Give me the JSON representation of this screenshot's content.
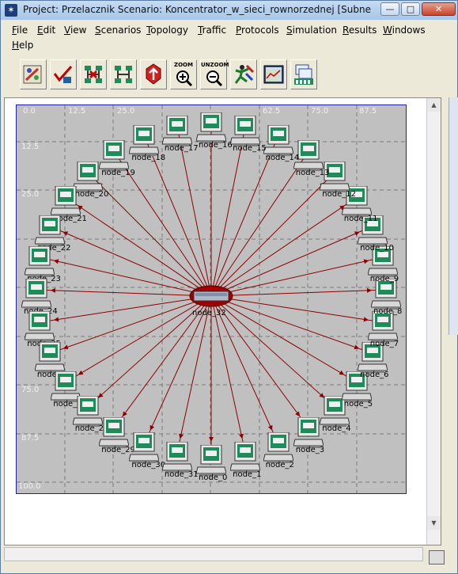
{
  "window": {
    "title": "Project: Przelacznik Scenario: Koncentrator_w_sieci_rownorzednej  [Subnet: top.Off",
    "min_glyph": "—",
    "max_glyph": "□",
    "close_glyph": "✕"
  },
  "menu": {
    "items": [
      "File",
      "Edit",
      "View",
      "Scenarios",
      "Topology",
      "Traffic",
      "Protocols",
      "Simulation",
      "Results",
      "Windows",
      "Help"
    ]
  },
  "toolbar": {
    "buttons": [
      {
        "icon": "open-palette-icon"
      },
      {
        "icon": "check-links-icon"
      },
      {
        "icon": "fail-link-icon"
      },
      {
        "icon": "recover-link-icon"
      },
      {
        "icon": "return-to-parent-icon"
      },
      {
        "icon": "zoom-in-icon",
        "caption": "ZOOM"
      },
      {
        "icon": "zoom-out-icon",
        "caption": "UNZOOM"
      },
      {
        "icon": "configure-run-simulation-icon"
      },
      {
        "icon": "view-results-icon"
      },
      {
        "icon": "hide-show-graphs-icon"
      }
    ]
  },
  "workspace": {
    "x_ticks": [
      "0.0",
      "12.5",
      "25.0",
      "62.5",
      "75.0",
      "87.5"
    ],
    "y_ticks": [
      "12.5",
      "25.0",
      "75.0",
      "87.5",
      "100.0"
    ],
    "hub": {
      "label": "node_32"
    },
    "nodes": [
      {
        "label": "node_0"
      },
      {
        "label": "node_1"
      },
      {
        "label": "node_2"
      },
      {
        "label": "node_3"
      },
      {
        "label": "node_4"
      },
      {
        "label": "node_5"
      },
      {
        "label": "node_6"
      },
      {
        "label": "node_7"
      },
      {
        "label": "node_8"
      },
      {
        "label": "node_9"
      },
      {
        "label": "node_10"
      },
      {
        "label": "node_11"
      },
      {
        "label": "node_12"
      },
      {
        "label": "node_13"
      },
      {
        "label": "node_14"
      },
      {
        "label": "node_15"
      },
      {
        "label": "node_16"
      },
      {
        "label": "node_17"
      },
      {
        "label": "node_18"
      },
      {
        "label": "node_19"
      },
      {
        "label": "node_20"
      },
      {
        "label": "node_21"
      },
      {
        "label": "node_22"
      },
      {
        "label": "node_23"
      },
      {
        "label": "node_24"
      },
      {
        "label": "node_25"
      },
      {
        "label": "node_26"
      },
      {
        "label": "node_27"
      },
      {
        "label": "node_28"
      },
      {
        "label": "node_29"
      },
      {
        "label": "node_30"
      },
      {
        "label": "node_31"
      }
    ]
  },
  "colors": {
    "link": "#8b0000",
    "screen": "#1f8a5a",
    "workspace": "#c0c0c0",
    "border": "#2020a0"
  }
}
